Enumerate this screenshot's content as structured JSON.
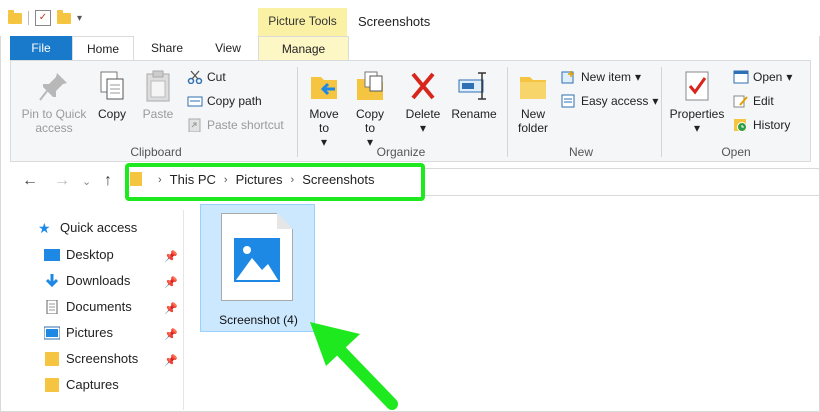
{
  "window": {
    "title": "Screenshots",
    "context_tab_header": "Picture Tools"
  },
  "tabs": {
    "file": "File",
    "home": "Home",
    "share": "Share",
    "view": "View",
    "manage": "Manage"
  },
  "ribbon": {
    "clipboard": {
      "label": "Clipboard",
      "pin": "Pin to Quick access",
      "copy": "Copy",
      "paste": "Paste",
      "cut": "Cut",
      "copy_path": "Copy path",
      "paste_shortcut": "Paste shortcut"
    },
    "organize": {
      "label": "Organize",
      "move_to": "Move to",
      "copy_to": "Copy to",
      "delete": "Delete",
      "rename": "Rename"
    },
    "new": {
      "label": "New",
      "new_folder": "New folder",
      "new_item": "New item",
      "easy_access": "Easy access"
    },
    "open": {
      "label": "Open",
      "properties": "Properties",
      "open": "Open",
      "edit": "Edit",
      "history": "History"
    }
  },
  "address": {
    "crumbs": [
      "This PC",
      "Pictures",
      "Screenshots"
    ]
  },
  "nav": {
    "quick_access": "Quick access",
    "items": [
      {
        "label": "Desktop",
        "icon": "desktop-icon",
        "pinned": true
      },
      {
        "label": "Downloads",
        "icon": "download-icon",
        "pinned": true
      },
      {
        "label": "Documents",
        "icon": "documents-icon",
        "pinned": true
      },
      {
        "label": "Pictures",
        "icon": "pictures-icon",
        "pinned": true
      },
      {
        "label": "Screenshots",
        "icon": "folder-icon",
        "pinned": true
      },
      {
        "label": "Captures",
        "icon": "folder-icon",
        "pinned": false
      }
    ]
  },
  "content": {
    "file_name": "Screenshot (4)"
  },
  "colors": {
    "highlight": "#1ee81e",
    "file_tab": "#1979ca",
    "selection": "#cce8ff"
  }
}
